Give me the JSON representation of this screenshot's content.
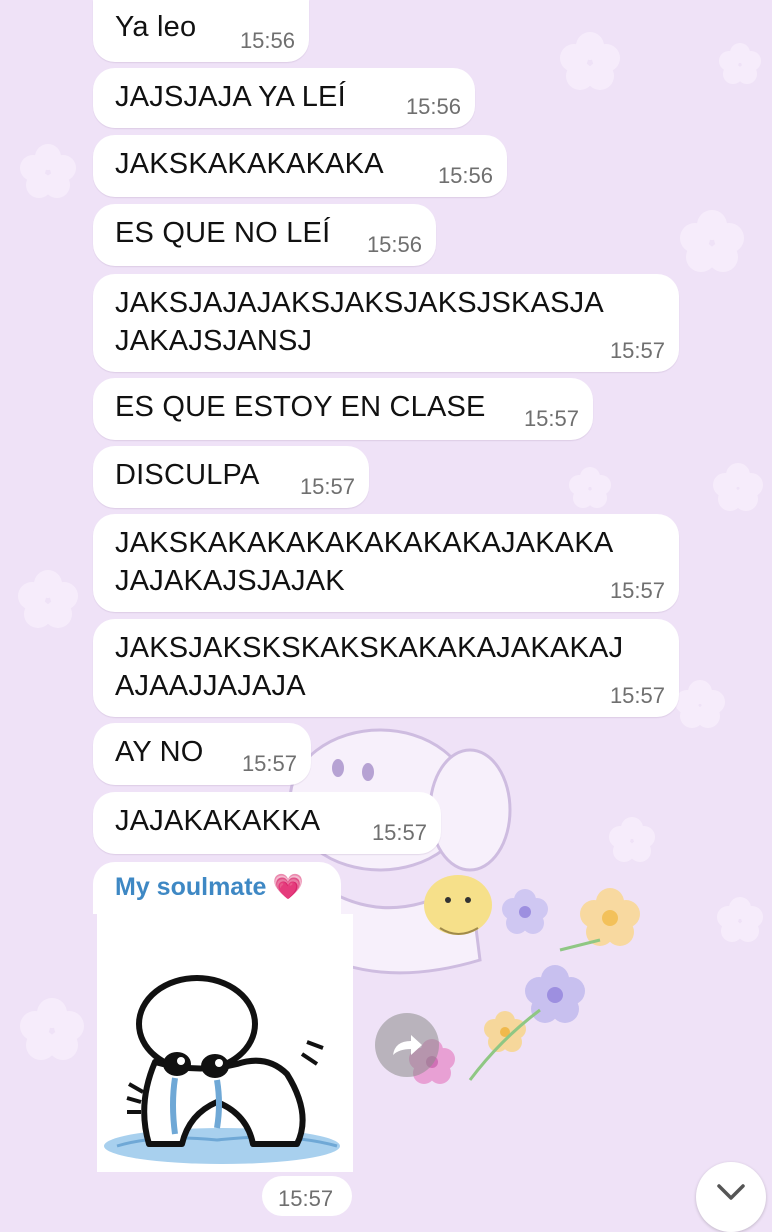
{
  "messages": [
    {
      "text": "Ya leo",
      "time": "15:56"
    },
    {
      "text": "JAJSJAJA YA LEÍ",
      "time": "15:56"
    },
    {
      "text": "JAKSKAKAKAKAKA",
      "time": "15:56"
    },
    {
      "text": "ES QUE NO LEÍ",
      "time": "15:56"
    },
    {
      "text": "JAKSJAJAJAKSJAKSJAKSJSKASJA\nJAKAJSJANSJ",
      "time": "15:57"
    },
    {
      "text": "ES QUE ESTOY EN CLASE",
      "time": "15:57"
    },
    {
      "text": "DISCULPA",
      "time": "15:57"
    },
    {
      "text": "JAKSKAKAKAKAKAKAKAKAJAKAKA\nJAJAKAJSJAJAK",
      "time": "15:57"
    },
    {
      "text": "JAKSJAKSKSKAKSKAKAKAJAKAKAJ\nAJAAJJAJAJA",
      "time": "15:57"
    },
    {
      "text": "AY NO",
      "time": "15:57"
    },
    {
      "text": "JAJAKAKAKKA",
      "time": "15:57"
    }
  ],
  "forwarded": {
    "sender_name": "My soulmate",
    "sender_emoji": "💗",
    "sticker_name": "crying-blob-sticker",
    "time": "15:57"
  },
  "icons": {
    "forward": "forward-icon",
    "scroll_down": "chevron-down-icon"
  },
  "colors": {
    "wallpaper": "#efe2f7",
    "bubble": "#ffffff",
    "sender_name": "#3e88c4",
    "time_text": "#6f6f6f"
  }
}
